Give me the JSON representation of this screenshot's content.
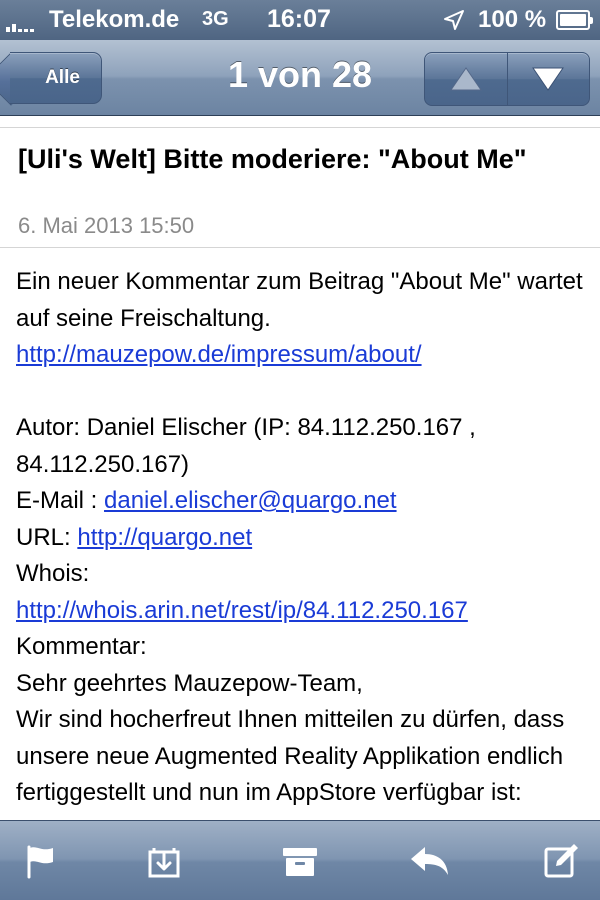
{
  "status_bar": {
    "carrier": "Telekom.de",
    "network": "3G",
    "time": "16:07",
    "battery_percent": "100 %",
    "battery_level": 1.0
  },
  "nav": {
    "back_label": "Alle",
    "title": "1 von 28",
    "prev_icon": "up-triangle-icon",
    "next_icon": "down-triangle-icon"
  },
  "message": {
    "subject": "[Uli's Welt] Bitte moderiere: \"About Me\"",
    "date": "6. Mai 2013 15:50",
    "intro": "Ein neuer Kommentar zum Beitrag \"About Me\" wartet auf seine Freischaltung.",
    "post_link": "http://mauzepow.de/impressum/about/",
    "author_line": "Autor: Daniel Elischer (IP: 84.112.250.167 , 84.112.250.167)",
    "email_label": "E-Mail : ",
    "email_link": "daniel.elischer@quargo.net",
    "url_label": "URL: ",
    "url_link": "http://quargo.net",
    "whois_label": "Whois:",
    "whois_link": "http://whois.arin.net/rest/ip/84.112.250.167",
    "comment_label": "Kommentar:",
    "comment_text_1": "Sehr geehrtes Mauzepow-Team,",
    "comment_text_2": "Wir sind hocherfreut Ihnen mitteilen zu dürfen, dass unsere neue Augmented Reality Applikation endlich fertiggestellt und nun im AppStore verfügbar ist:"
  },
  "toolbar": {
    "items": [
      "flag-icon",
      "move-folder-icon",
      "archive-icon",
      "reply-icon",
      "compose-icon"
    ]
  },
  "colors": {
    "link": "#1a3bd6",
    "bar_blue": "#6c84a2",
    "date_gray": "#8a8a8a"
  }
}
